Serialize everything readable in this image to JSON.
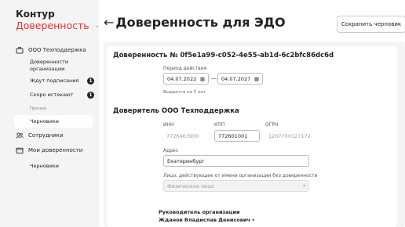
{
  "brand": {
    "top": "Контур",
    "bottom": "Доверенность"
  },
  "sidebar": {
    "org_name": "ООО Техподдержка",
    "org_items": [
      {
        "label": "Доверенности организации"
      },
      {
        "label": "Ждут подписания",
        "badge": "1"
      },
      {
        "label": "Скоро истекают",
        "badge": "1"
      }
    ],
    "other_label": "Прочее",
    "drafts_label": "Черновики",
    "employees_label": "Сотрудники",
    "my_poa_label": "Мои доверенности",
    "my_drafts_label": "Черновики"
  },
  "header": {
    "back": "←",
    "title": "Доверенность для ЭДО",
    "save_label": "Сохранить черновик"
  },
  "poa": {
    "number_title": "Доверенность № 0f5e1a99-c052-4e55-ab1d-6c2bfc86dc6d",
    "period_label": "Период действия",
    "date_from": "04.07.2022",
    "date_to": "04.07.2027",
    "dash": "—",
    "issued_for": "Выдается на 5 лет"
  },
  "principal": {
    "title": "Доверитель ООО Техподдержка",
    "inn_label": "ИНН",
    "inn_value": "7726463900",
    "kpp_label": "КПП",
    "kpp_value": "772601001",
    "ogrn_label": "ОГРН",
    "ogrn_value": "1207700127172",
    "address_label": "Адрес",
    "address_value": "Екатеринбург",
    "acting_label": "Лицо, действующее от имени организации без доверенности",
    "acting_value": "Физическое лицо",
    "head_label": "Руководитель организации",
    "head_value": "Жданов Владислав Денисович"
  },
  "colors": {
    "accent": "#e3343b"
  }
}
